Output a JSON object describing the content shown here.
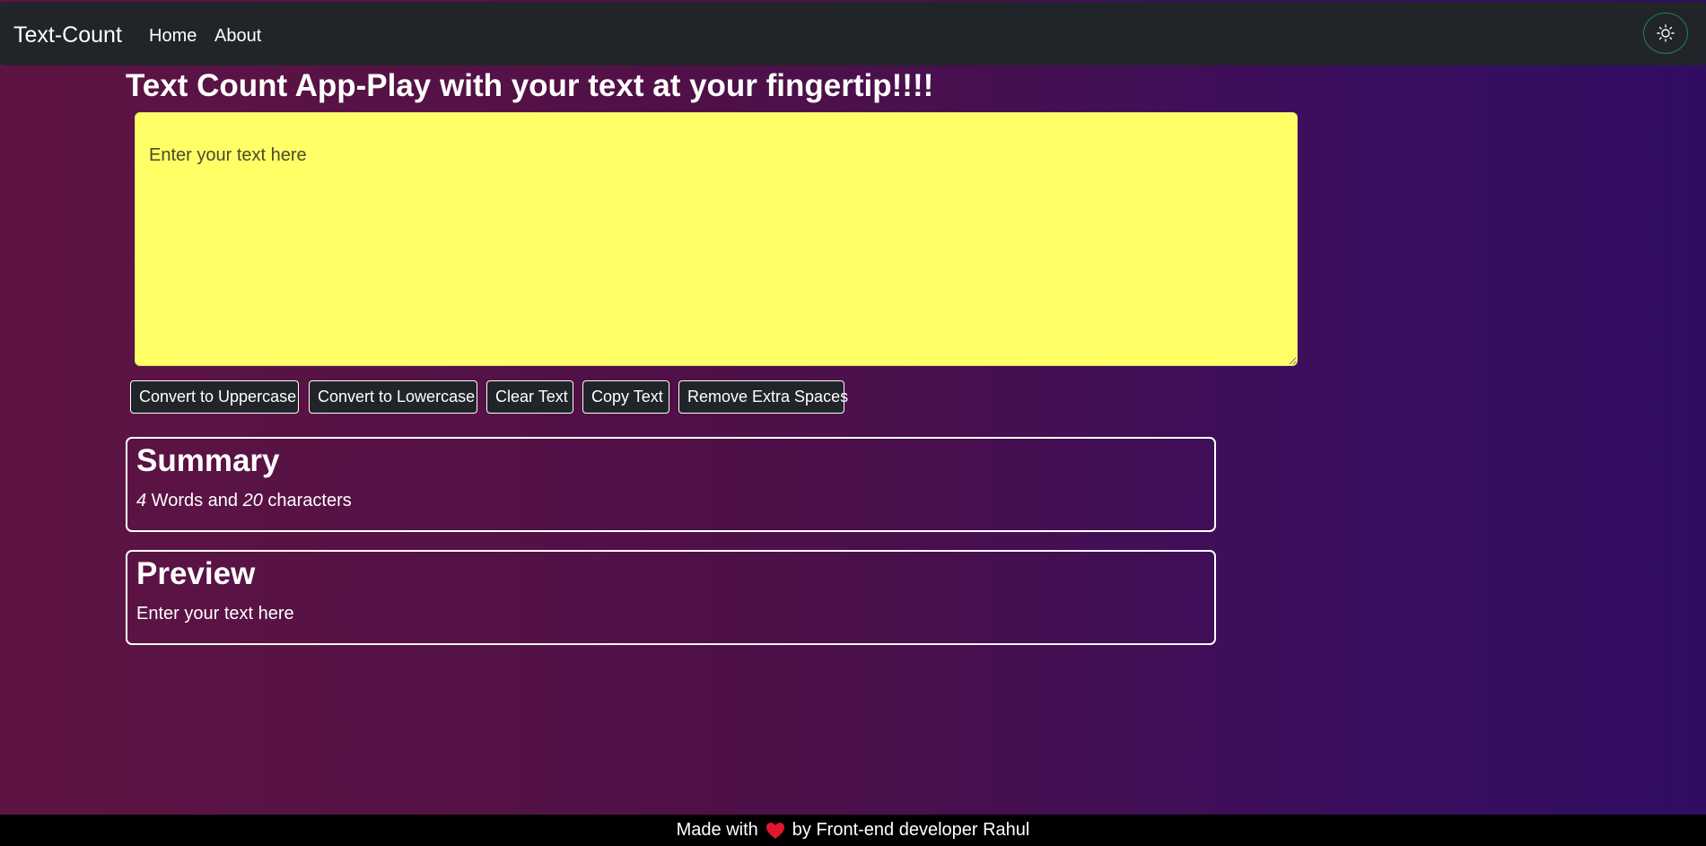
{
  "navbar": {
    "brand": "Text-Count",
    "links": [
      {
        "label": "Home"
      },
      {
        "label": "About"
      }
    ],
    "theme_toggle_icon": "sun-icon"
  },
  "main": {
    "title": "Text Count App-Play with your text at your fingertip!!!!",
    "textarea": {
      "value": "",
      "placeholder": "Enter your text here",
      "background": "#ffff66"
    },
    "buttons": {
      "uppercase": "Convert to Uppercase",
      "lowercase": "Convert to Lowercase",
      "clear": "Clear Text",
      "copy": "Copy Text",
      "remove_spaces": "Remove Extra Spaces"
    },
    "summary": {
      "title": "Summary",
      "word_count": "4",
      "words_label": " Words and ",
      "char_count": "20",
      "chars_label": " characters"
    },
    "preview": {
      "title": "Preview",
      "text": "Enter your text here"
    }
  },
  "footer": {
    "prefix": "Made with",
    "icon": "heart-icon",
    "suffix": "by Front-end developer Rahul",
    "heart_color": "#e0182d"
  },
  "colors": {
    "navbar_bg": "#212529",
    "toggle_border": "#198754",
    "footer_bg": "#000000"
  }
}
